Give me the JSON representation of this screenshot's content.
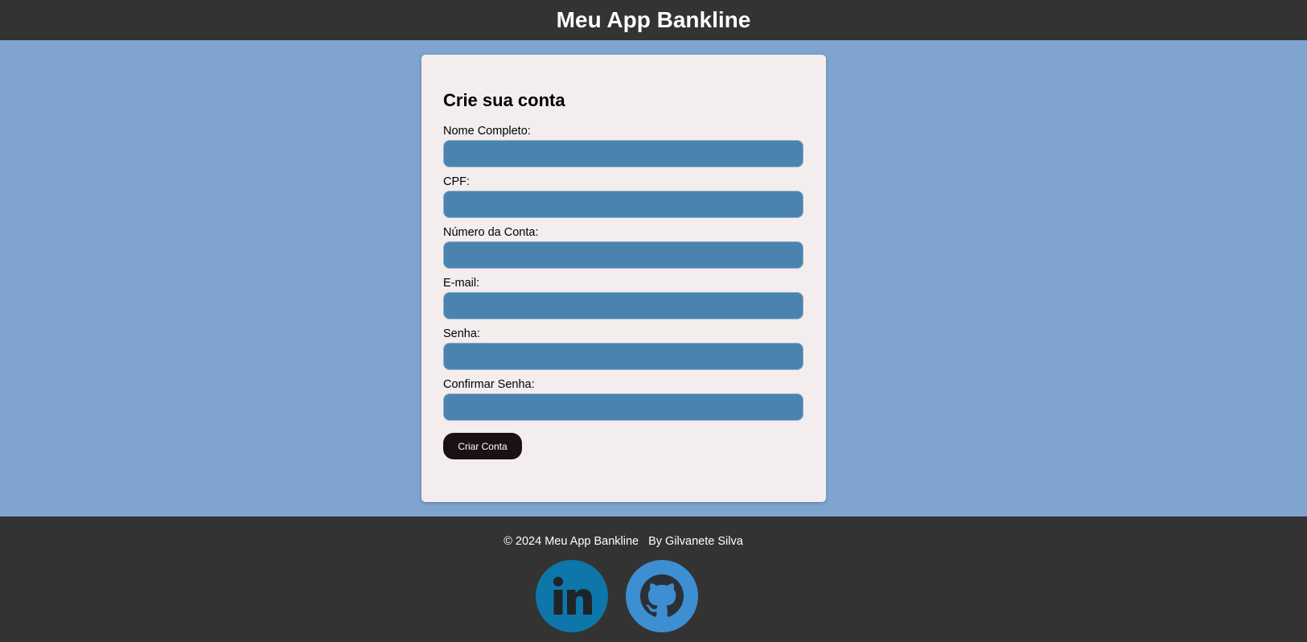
{
  "header": {
    "title": "Meu App Bankline"
  },
  "form": {
    "title": "Crie sua conta",
    "fields": [
      {
        "label": "Nome Completo:",
        "value": ""
      },
      {
        "label": "CPF:",
        "value": ""
      },
      {
        "label": "Número da Conta:",
        "value": ""
      },
      {
        "label": "E-mail:",
        "value": ""
      },
      {
        "label": "Senha:",
        "value": ""
      },
      {
        "label": "Confirmar Senha:",
        "value": ""
      }
    ],
    "submit_label": "Criar Conta"
  },
  "footer": {
    "copyright": "© 2024 Meu App Bankline",
    "author": "By Gilvanete Silva",
    "social": [
      {
        "icon": "linkedin-icon"
      },
      {
        "icon": "github-icon"
      }
    ]
  },
  "colors": {
    "header_bg": "#333333",
    "page_bg": "#7fa4d0",
    "card_bg": "#f4eded",
    "input_bg": "#4b83b0",
    "button_bg": "#1a1117",
    "linkedin": "#0e76a8",
    "github": "#3d8fd1"
  }
}
